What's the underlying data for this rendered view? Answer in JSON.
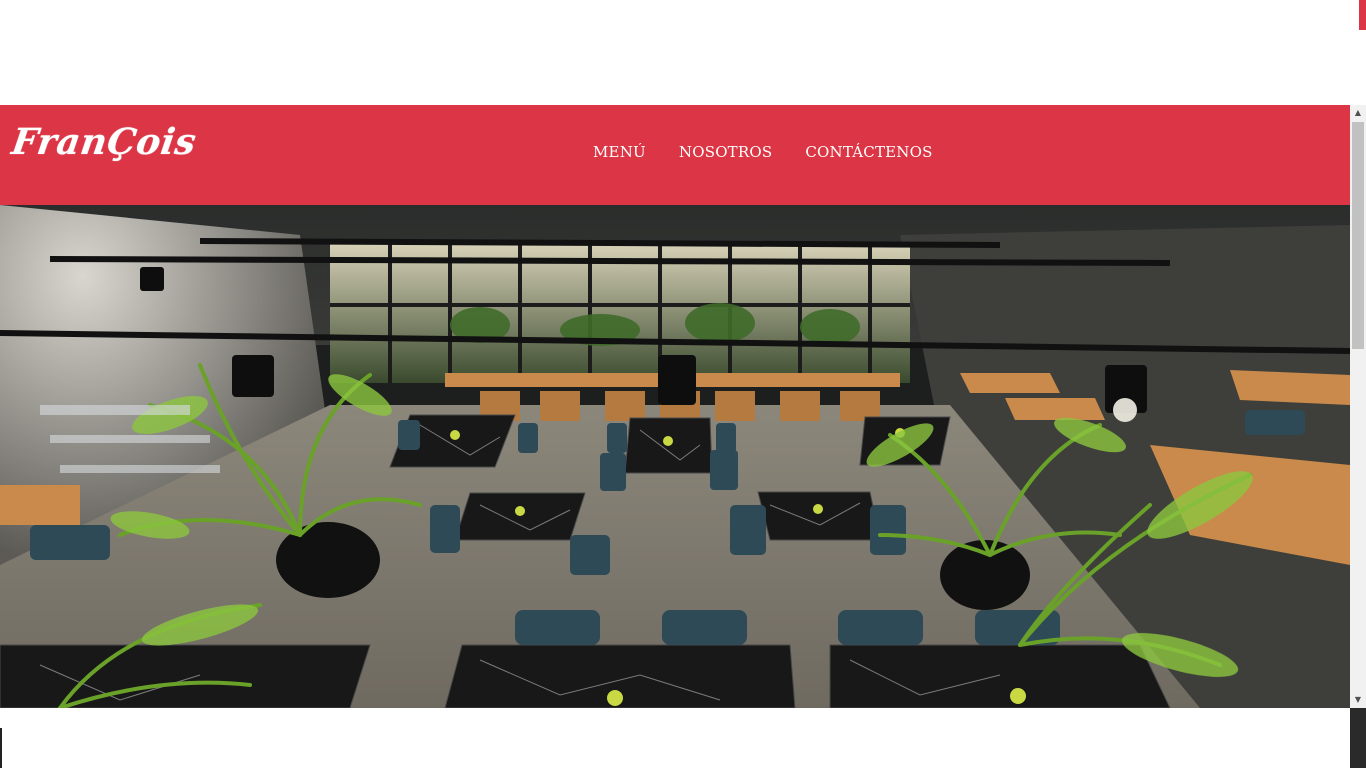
{
  "brand": {
    "name": "FranÇois"
  },
  "nav": {
    "items": [
      {
        "label": "MENÚ"
      },
      {
        "label": "NOSOTROS"
      },
      {
        "label": "CONTÁCTENOS"
      }
    ]
  },
  "hero": {
    "icon": "restaurant-interior-photo"
  },
  "colors": {
    "brand_red": "#dc3545",
    "nav_text": "#ffffff",
    "page_bg": "#ffffff"
  },
  "scrollbar": {
    "up_icon": "▲",
    "down_icon": "▼"
  }
}
